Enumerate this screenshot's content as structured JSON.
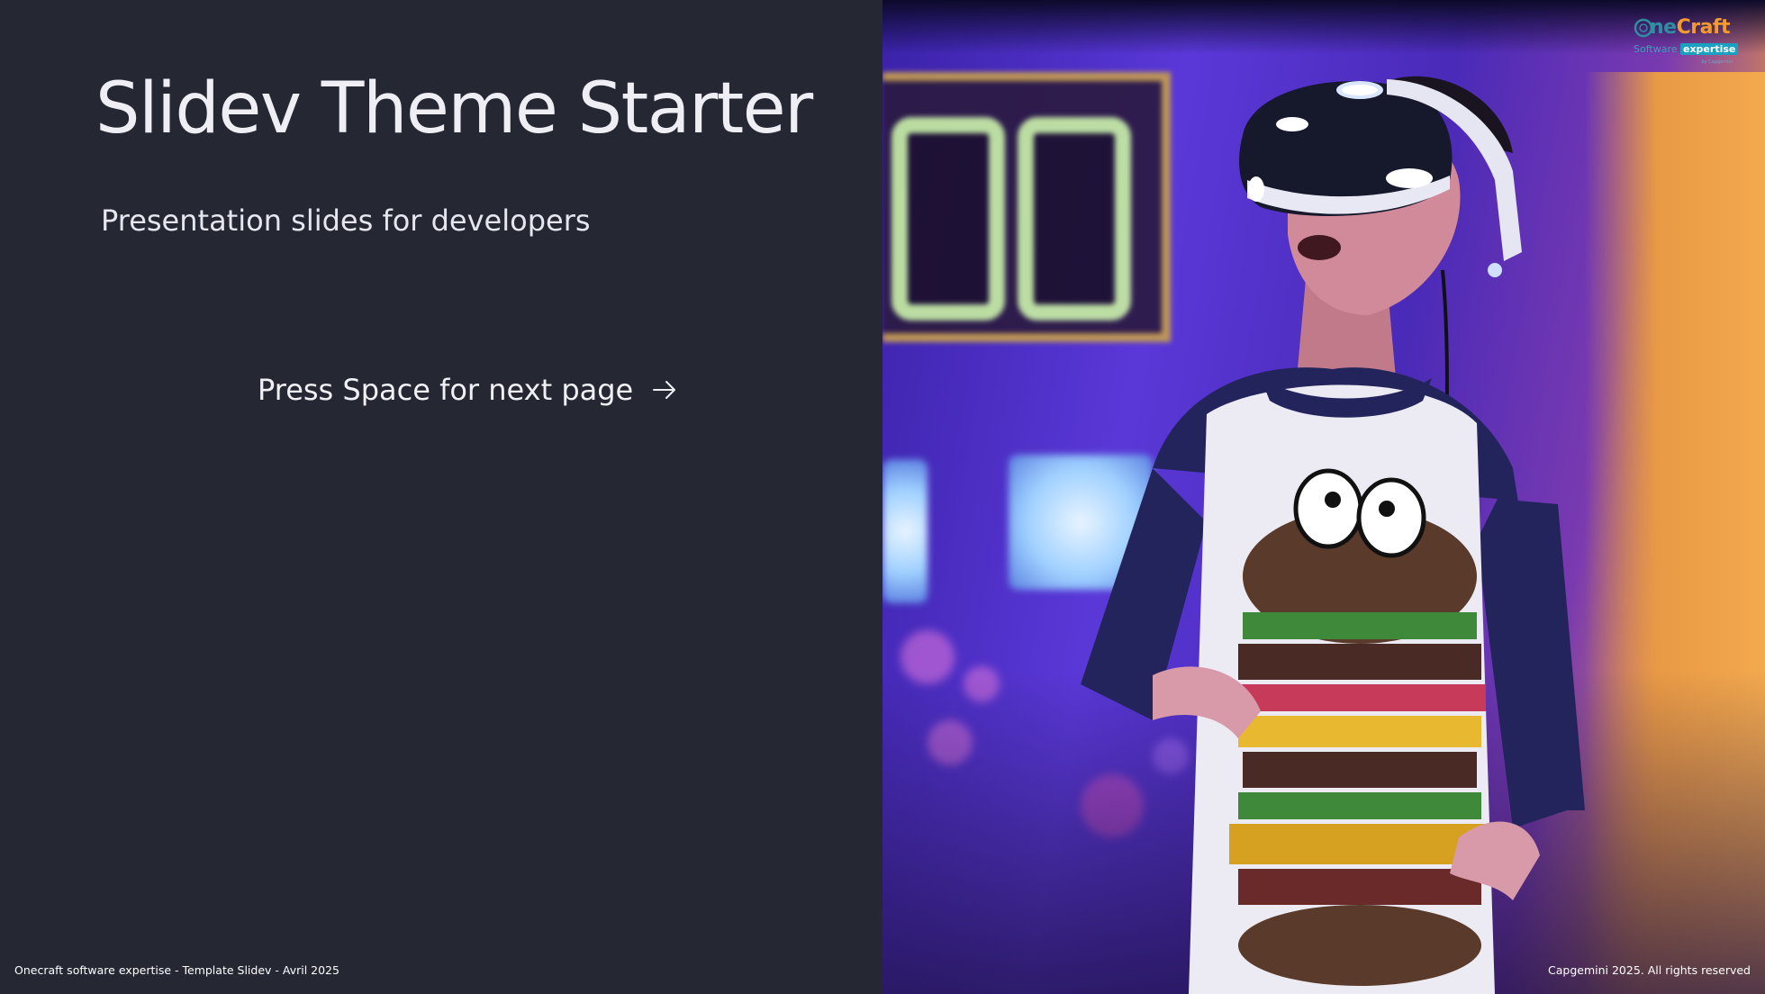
{
  "slide": {
    "title": "Slidev Theme Starter",
    "subtitle": "Presentation slides for developers",
    "next_label": "Press Space for next page",
    "next_icon": "arrow-right-icon"
  },
  "footer": {
    "left": "Onecraft software expertise - Template Slidev - Avril 2025",
    "right": "Capgemini 2025. All rights reserved"
  },
  "logo": {
    "word_part1": "ne",
    "word_part2": "Craft",
    "tag_part1": "Software",
    "tag_part2": "expertise",
    "byline": "by Capgemini"
  },
  "photo": {
    "subject": "person-wearing-vr-headset"
  },
  "colors": {
    "background": "#252733",
    "text": "#eeeef4",
    "logo_teal": "#2d8fa0",
    "logo_orange": "#f29a2e"
  }
}
